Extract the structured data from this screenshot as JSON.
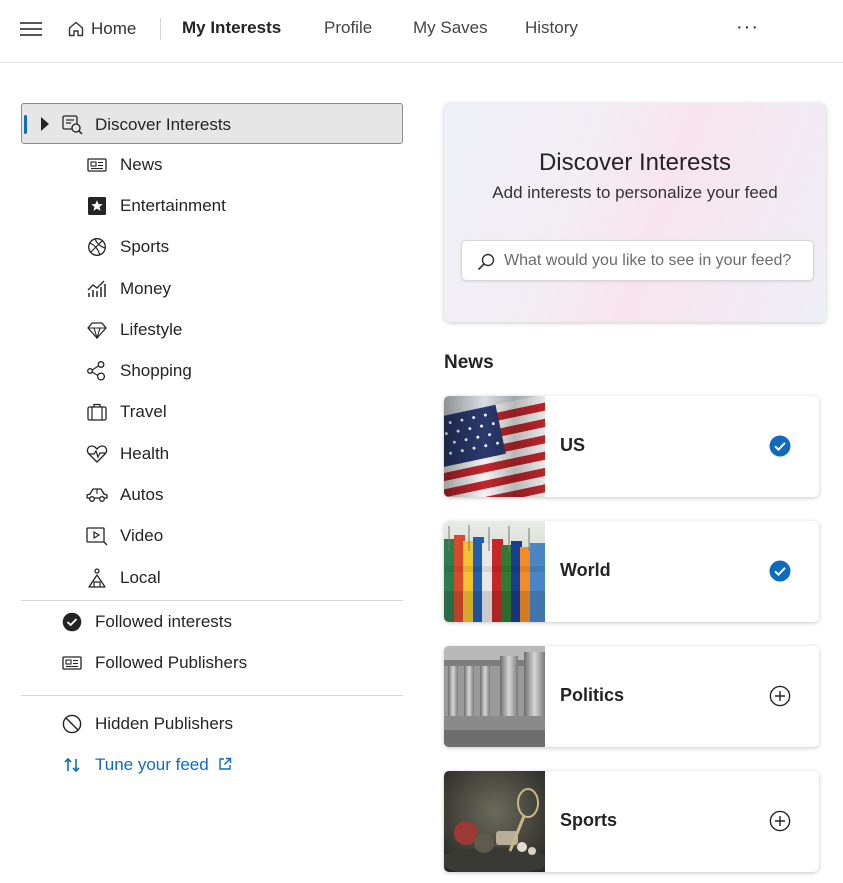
{
  "topnav": {
    "home_label": "Home",
    "tabs": [
      {
        "label": "My Interests",
        "active": true
      },
      {
        "label": "Profile",
        "active": false
      },
      {
        "label": "My Saves",
        "active": false
      },
      {
        "label": "History",
        "active": false
      }
    ],
    "more_label": "···"
  },
  "sidebar": {
    "discover": {
      "label": "Discover Interests",
      "icon": "discover-icon"
    },
    "categories": [
      {
        "label": "News",
        "icon": "newspaper-icon"
      },
      {
        "label": "Entertainment",
        "icon": "star-icon"
      },
      {
        "label": "Sports",
        "icon": "ball-icon"
      },
      {
        "label": "Money",
        "icon": "chart-icon"
      },
      {
        "label": "Lifestyle",
        "icon": "diamond-icon"
      },
      {
        "label": "Shopping",
        "icon": "shopping-icon"
      },
      {
        "label": "Travel",
        "icon": "suitcase-icon"
      },
      {
        "label": "Health",
        "icon": "heart-pulse-icon"
      },
      {
        "label": "Autos",
        "icon": "car-icon"
      },
      {
        "label": "Video",
        "icon": "video-icon"
      },
      {
        "label": "Local",
        "icon": "local-icon"
      }
    ],
    "followed_interests": {
      "label": "Followed interests",
      "icon": "check-circle-icon"
    },
    "followed_publishers": {
      "label": "Followed Publishers",
      "icon": "newspaper-icon"
    },
    "hidden_publishers": {
      "label": "Hidden Publishers",
      "icon": "block-icon"
    },
    "tune_feed": {
      "label": "Tune your feed",
      "icon": "sort-arrows-icon",
      "external_icon": "external-link-icon"
    }
  },
  "hero": {
    "title": "Discover Interests",
    "subtitle": "Add interests to personalize your feed",
    "search_placeholder": "What would you like to see in your feed?"
  },
  "news_section": {
    "title": "News",
    "topics": [
      {
        "name": "US",
        "followed": true
      },
      {
        "name": "World",
        "followed": true
      },
      {
        "name": "Politics",
        "followed": false
      },
      {
        "name": "Sports",
        "followed": false
      }
    ]
  },
  "colors": {
    "accent": "#0f6cbd",
    "text": "#242424",
    "selected_bg": "#e6e6e6"
  }
}
